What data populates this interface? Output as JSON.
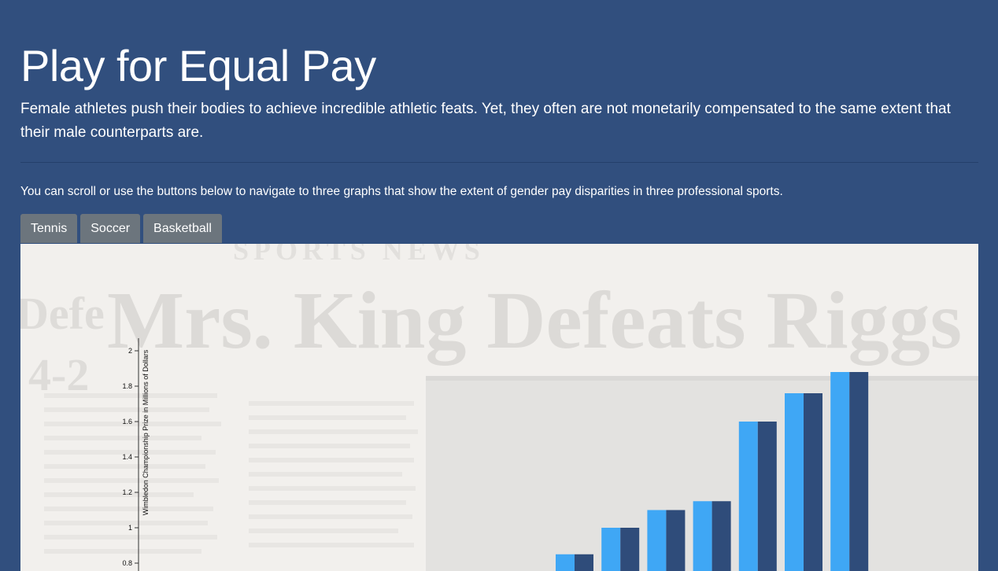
{
  "header": {
    "title": "Play for Equal Pay",
    "lead": "Female athletes push their bodies to achieve incredible athletic feats. Yet, they often are not monetarily compensated to the same extent that their male counterparts are."
  },
  "navigation": {
    "instructions": "You can scroll or use the buttons below to navigate to three graphs that show the extent of gender pay disparities in three professional sports.",
    "buttons": [
      "Tennis",
      "Soccer",
      "Basketball"
    ]
  },
  "background_image": {
    "description_text": "SPORTS NEWS",
    "headline": "Mrs. King Defeats Riggs",
    "side_text": "Defe",
    "score": "4-2"
  },
  "colors": {
    "page_background": "#314f7e",
    "button": "#6c757d",
    "series_women": "#3fa7f5",
    "series_men": "#2f4c7a"
  },
  "chart_data": {
    "type": "bar",
    "title": "",
    "xlabel": "",
    "ylabel": "Wimbledon Championship Prize in Millions of Dollars",
    "ylim": [
      0.8,
      2.0
    ],
    "yticks": [
      "0.8",
      "1",
      "1.2",
      "1.4",
      "1.6",
      "1.8",
      "2"
    ],
    "series": [
      {
        "values": [
          0.85,
          1.0,
          1.1,
          1.15,
          1.6,
          1.76,
          1.88
        ]
      },
      {
        "values": [
          0.85,
          1.0,
          1.1,
          1.15,
          1.6,
          1.76,
          1.88
        ]
      }
    ]
  }
}
